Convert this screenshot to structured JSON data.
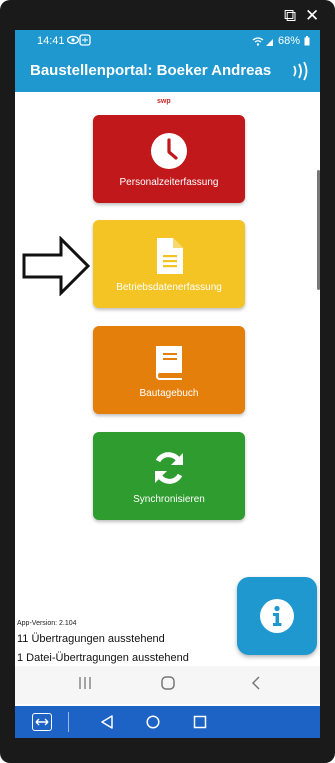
{
  "window": {
    "popout_icon": "popout-icon",
    "close_icon": "close-icon"
  },
  "status_bar": {
    "time": "14:41",
    "battery": "68%"
  },
  "app": {
    "title": "Baustellenportal: Boeker Andreas",
    "logo_text": "swp"
  },
  "tiles": [
    {
      "label": "Personalzeiterfassung",
      "icon": "clock-icon",
      "color": "#c0181b"
    },
    {
      "label": "Betriebsdatenerfassung",
      "icon": "document-icon",
      "color": "#f3c423"
    },
    {
      "label": "Bautagebuch",
      "icon": "book-icon",
      "color": "#e47f0c"
    },
    {
      "label": "Synchronisieren",
      "icon": "sync-icon",
      "color": "#2e9c2e"
    }
  ],
  "footer": {
    "app_version": "App-Version: 2.104",
    "pending_transfers": "11 Übertragungen ausstehend",
    "pending_file_transfers": "1 Datei-Übertragungen ausstehend"
  },
  "accent_color": "#1e98cf"
}
